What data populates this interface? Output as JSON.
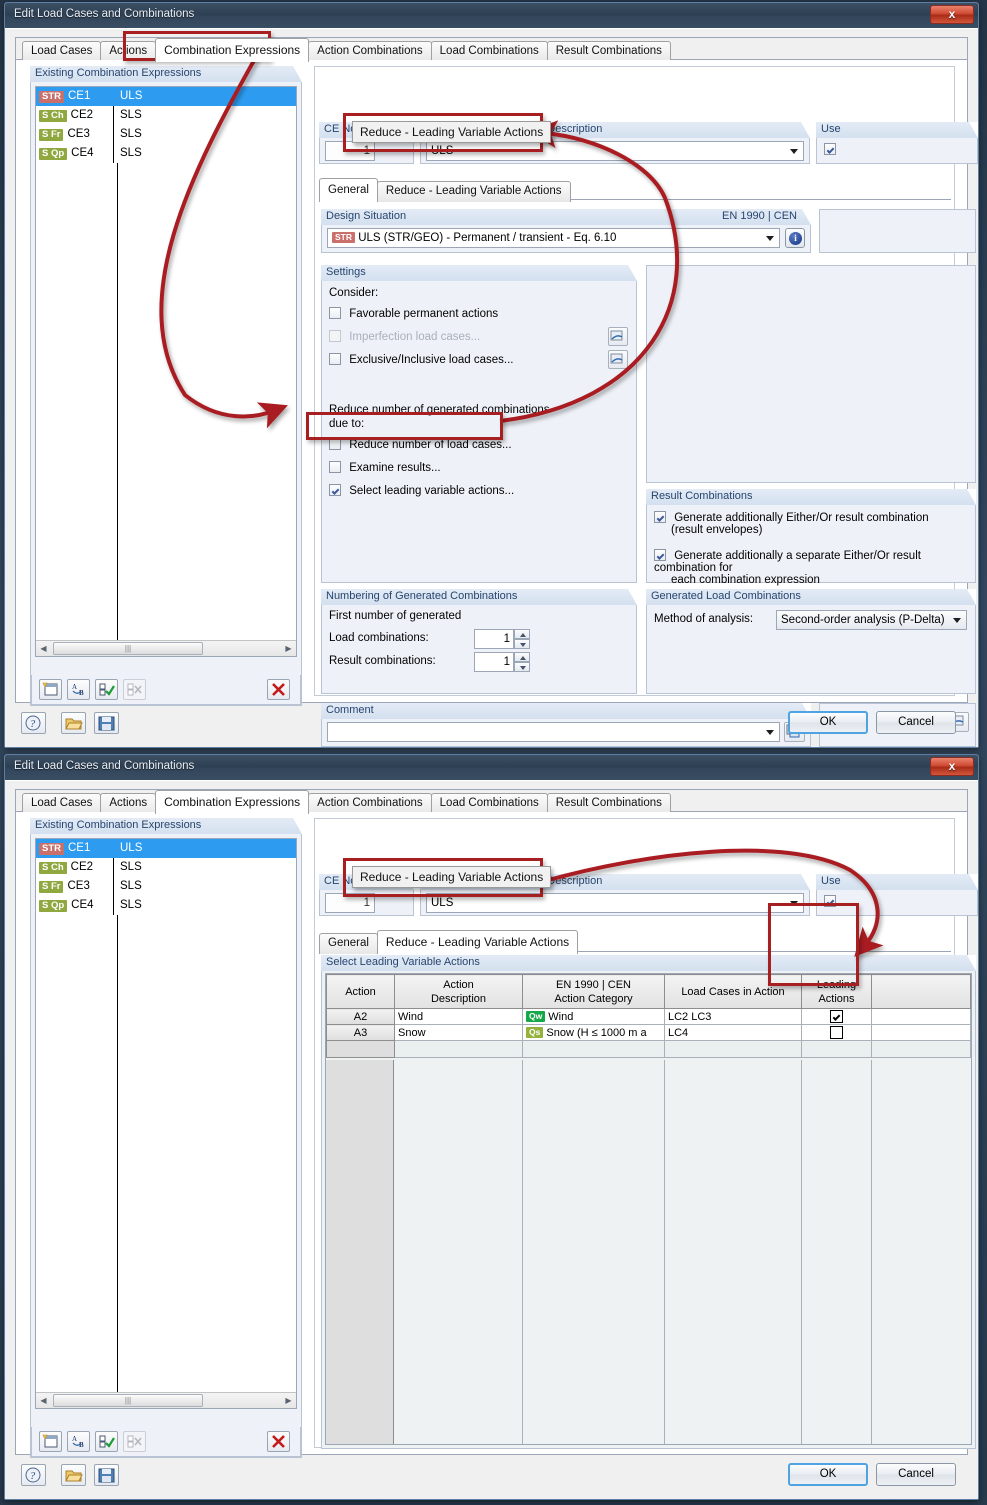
{
  "window_title": "Edit Load Cases and Combinations",
  "close_label": "x",
  "tabs": [
    {
      "label": "Load Cases",
      "active": false
    },
    {
      "label": "Actions",
      "active": false
    },
    {
      "label": "Combination Expressions",
      "active": true
    },
    {
      "label": "Action Combinations",
      "active": false
    },
    {
      "label": "Load Combinations",
      "active": false
    },
    {
      "label": "Result Combinations",
      "active": false
    }
  ],
  "existing": {
    "title": "Existing Combination Expressions",
    "rows": [
      {
        "badge": "STR",
        "badge_type": "str",
        "id": "CE1",
        "desc": "ULS",
        "selected": true
      },
      {
        "badge": "S Ch",
        "badge_type": "sls",
        "id": "CE2",
        "desc": "SLS",
        "selected": false
      },
      {
        "badge": "S Fr",
        "badge_type": "sls",
        "id": "CE3",
        "desc": "SLS",
        "selected": false
      },
      {
        "badge": "S Qp",
        "badge_type": "sls",
        "id": "CE4",
        "desc": "SLS",
        "selected": false
      }
    ]
  },
  "list_toolbar": {
    "new_icon": "new-page-icon",
    "rename_icon": "rename-ab-icon",
    "check_all_icon": "check-all-icon",
    "uncheck_all_icon": "uncheck-all-icon",
    "delete_icon": "delete-x-icon"
  },
  "ce_no": {
    "title": "CE No.",
    "value": "1"
  },
  "description": {
    "title": "Combination Expression Description",
    "value": "ULS"
  },
  "use": {
    "title": "Use",
    "checked": true
  },
  "inner_tabs": [
    {
      "label": "General",
      "active": true
    },
    {
      "label": "Reduce - Leading Variable Actions",
      "active": false
    }
  ],
  "design_situation": {
    "title": "Design Situation",
    "standard": "EN 1990 | CEN",
    "badge": "STR",
    "value": "ULS (STR/GEO) - Permanent / transient - Eq. 6.10",
    "info_icon": "info-icon"
  },
  "settings": {
    "title": "Settings",
    "consider_label": "Consider:",
    "items": [
      {
        "label": "Favorable permanent actions",
        "checked": false,
        "disabled": false,
        "picker": false
      },
      {
        "label": "Imperfection load cases...",
        "checked": false,
        "disabled": true,
        "picker": true
      },
      {
        "label": "Exclusive/Inclusive load cases...",
        "checked": false,
        "disabled": false,
        "picker": true
      }
    ],
    "reduce_label_1": "Reduce number of generated combinations",
    "reduce_label_2": "due to:",
    "reduce_items": [
      {
        "label": "Reduce number of load cases...",
        "checked": false
      },
      {
        "label": "Examine results...",
        "checked": false
      },
      {
        "label": "Select leading variable actions...",
        "checked": true
      }
    ]
  },
  "result_combinations": {
    "title": "Result Combinations",
    "items": [
      {
        "line1": "Generate additionally Either/Or result combination",
        "line2": "(result envelopes)",
        "checked": true
      },
      {
        "line1": "Generate additionally a separate Either/Or result combination for",
        "line2": "each combination expression",
        "checked": true
      }
    ]
  },
  "generated_load_combinations": {
    "title": "Generated Load Combinations",
    "method_label": "Method of analysis:",
    "method_value": "Second-order analysis (P-Delta)"
  },
  "numbering": {
    "title": "Numbering of Generated Combinations",
    "intro": "First number of generated",
    "rows": [
      {
        "label": "Load combinations:",
        "value": "1"
      },
      {
        "label": "Result combinations:",
        "value": "1"
      }
    ]
  },
  "comment": {
    "title": "Comment",
    "value": "",
    "placeholder": "",
    "picker_icon": "copy-icon"
  },
  "right_panel_picker_icon": "settings-picker-icon",
  "dialog_footer": {
    "help_icon": "help-icon",
    "open_icon": "open-folder-icon",
    "save_icon": "save-disk-icon",
    "ok_label": "OK",
    "cancel_label": "Cancel"
  },
  "annotation": {
    "tab_callout": "Reduce - Leading Variable Actions",
    "color": "#a81f21"
  },
  "leading_panel": {
    "title": "Select Leading Variable Actions",
    "columns": [
      {
        "line1": "",
        "line2": "Action"
      },
      {
        "line1": "Action",
        "line2": "Description"
      },
      {
        "line1": "EN 1990 | CEN",
        "line2": "Action Category"
      },
      {
        "line1": "",
        "line2": "Load Cases in Action"
      },
      {
        "line1": "Leading",
        "line2": "Actions"
      },
      {
        "line1": "",
        "line2": ""
      }
    ],
    "rows": [
      {
        "action": "A2",
        "description": "Wind",
        "category_badge": "Qw",
        "category_badge_type": "qw",
        "category": "Wind",
        "load_cases": "LC2 LC3",
        "leading": true
      },
      {
        "action": "A3",
        "description": "Snow",
        "category_badge": "Qs",
        "category_badge_type": "qs",
        "category": "Snow (H ≤ 1000 m a",
        "load_cases": "LC4",
        "leading": false
      }
    ]
  }
}
